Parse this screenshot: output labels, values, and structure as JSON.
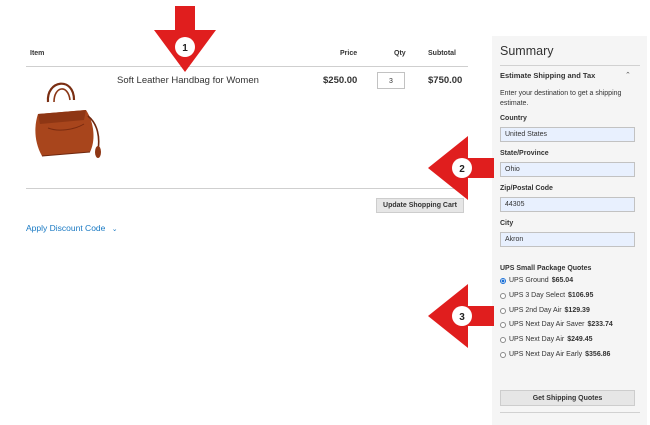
{
  "cart": {
    "headers": {
      "item": "Item",
      "price": "Price",
      "qty": "Qty",
      "subtotal": "Subtotal"
    },
    "items": [
      {
        "name": "Soft Leather Handbag for Women",
        "price": "$250.00",
        "qty": "3",
        "subtotal": "$750.00",
        "image_icon": "handbag-image"
      }
    ],
    "update_button": "Update Shopping Cart",
    "discount_link": "Apply Discount Code"
  },
  "summary": {
    "title": "Summary",
    "estimate_title": "Estimate Shipping and Tax",
    "estimate_desc": "Enter your destination to get a shipping estimate.",
    "fields": {
      "country": {
        "label": "Country",
        "value": "United States"
      },
      "state": {
        "label": "State/Province",
        "value": "Ohio"
      },
      "zip": {
        "label": "Zip/Postal Code",
        "value": "44305"
      },
      "city": {
        "label": "City",
        "value": "Akron"
      }
    },
    "ups_title": "UPS Small Package Quotes",
    "rates": [
      {
        "label": "UPS Ground",
        "price": "$65.04",
        "selected": true
      },
      {
        "label": "UPS 3 Day Select",
        "price": "$106.95",
        "selected": false
      },
      {
        "label": "UPS 2nd Day Air",
        "price": "$129.39",
        "selected": false
      },
      {
        "label": "UPS Next Day Air Saver",
        "price": "$233.74",
        "selected": false
      },
      {
        "label": "UPS Next Day Air",
        "price": "$249.45",
        "selected": false
      },
      {
        "label": "UPS Next Day Air Early",
        "price": "$356.86",
        "selected": false
      }
    ],
    "get_quotes_button": "Get Shipping Quotes"
  },
  "callouts": [
    "1",
    "2",
    "3"
  ],
  "colors": {
    "accent_link": "#1979c3",
    "callout_red": "#e01e1e",
    "field_bg": "#e8f0fe",
    "summary_bg": "#f5f5f5"
  }
}
